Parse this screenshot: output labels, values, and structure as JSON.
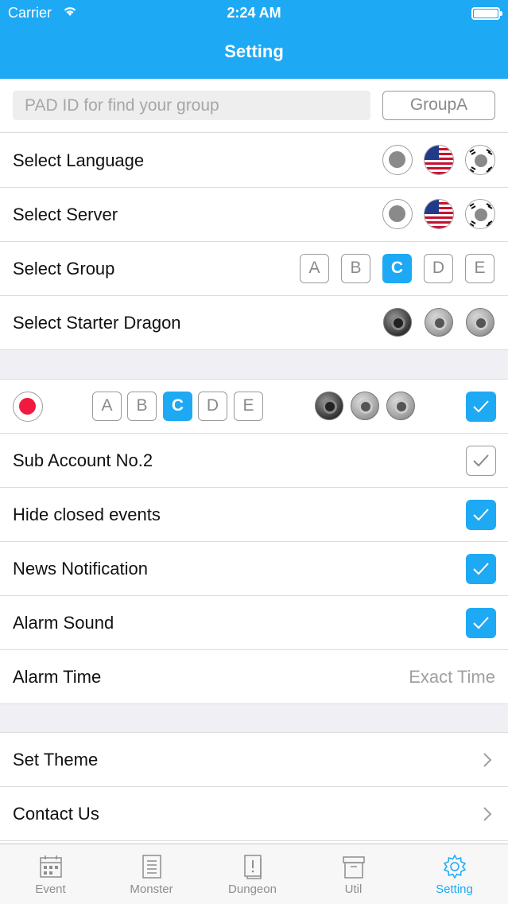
{
  "status_bar": {
    "carrier": "Carrier",
    "time": "2:24 AM"
  },
  "nav": {
    "title": "Setting"
  },
  "pad": {
    "placeholder": "PAD ID for find your group",
    "group_button": "GroupA"
  },
  "settings": {
    "language": {
      "label": "Select Language",
      "options": [
        "none",
        "us-flag",
        "korea-flag"
      ]
    },
    "server": {
      "label": "Select Server",
      "options": [
        "none",
        "us-flag",
        "korea-flag"
      ]
    },
    "group": {
      "label": "Select Group",
      "options": [
        "A",
        "B",
        "C",
        "D",
        "E"
      ],
      "selected": "C"
    },
    "starter": {
      "label": "Select Starter Dragon",
      "options": [
        "dark-dragon",
        "water-dragon",
        "wind-dragon"
      ]
    }
  },
  "account_row": {
    "groups": [
      "A",
      "B",
      "C",
      "D",
      "E"
    ],
    "selected": "C",
    "checked": true
  },
  "toggles": [
    {
      "label": "Sub Account No.2",
      "checked": false
    },
    {
      "label": "Hide closed events",
      "checked": true
    },
    {
      "label": "News Notification",
      "checked": true
    },
    {
      "label": "Alarm Sound",
      "checked": true
    }
  ],
  "alarm_time": {
    "label": "Alarm Time",
    "value": "Exact Time"
  },
  "links": [
    {
      "label": "Set Theme"
    },
    {
      "label": "Contact Us"
    }
  ],
  "tabs": [
    {
      "label": "Event",
      "icon": "calendar-icon"
    },
    {
      "label": "Monster",
      "icon": "list-icon"
    },
    {
      "label": "Dungeon",
      "icon": "alert-book-icon"
    },
    {
      "label": "Util",
      "icon": "archive-box-icon"
    },
    {
      "label": "Setting",
      "icon": "gear-icon",
      "active": true
    }
  ],
  "colors": {
    "accent": "#1ea9f5",
    "record": "#f0193f"
  }
}
